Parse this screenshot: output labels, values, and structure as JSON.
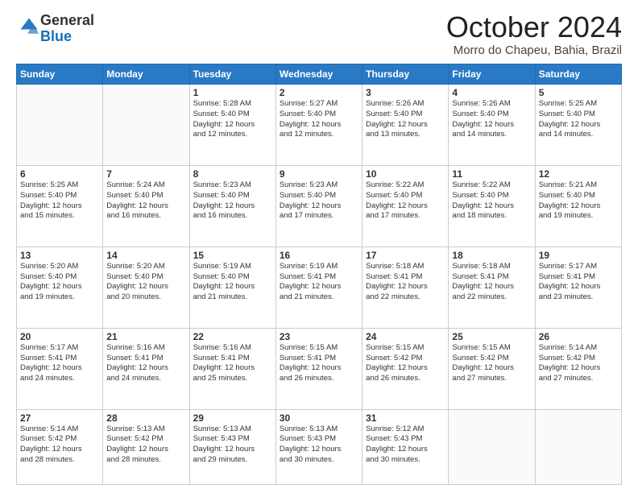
{
  "logo": {
    "general": "General",
    "blue": "Blue"
  },
  "header": {
    "month": "October 2024",
    "location": "Morro do Chapeu, Bahia, Brazil"
  },
  "weekdays": [
    "Sunday",
    "Monday",
    "Tuesday",
    "Wednesday",
    "Thursday",
    "Friday",
    "Saturday"
  ],
  "weeks": [
    [
      {
        "day": null
      },
      {
        "day": null
      },
      {
        "day": "1",
        "sunrise": "5:28 AM",
        "sunset": "5:40 PM",
        "daylight": "12 hours and 12 minutes."
      },
      {
        "day": "2",
        "sunrise": "5:27 AM",
        "sunset": "5:40 PM",
        "daylight": "12 hours and 12 minutes."
      },
      {
        "day": "3",
        "sunrise": "5:26 AM",
        "sunset": "5:40 PM",
        "daylight": "12 hours and 13 minutes."
      },
      {
        "day": "4",
        "sunrise": "5:26 AM",
        "sunset": "5:40 PM",
        "daylight": "12 hours and 14 minutes."
      },
      {
        "day": "5",
        "sunrise": "5:25 AM",
        "sunset": "5:40 PM",
        "daylight": "12 hours and 14 minutes."
      }
    ],
    [
      {
        "day": "6",
        "sunrise": "5:25 AM",
        "sunset": "5:40 PM",
        "daylight": "12 hours and 15 minutes."
      },
      {
        "day": "7",
        "sunrise": "5:24 AM",
        "sunset": "5:40 PM",
        "daylight": "12 hours and 16 minutes."
      },
      {
        "day": "8",
        "sunrise": "5:23 AM",
        "sunset": "5:40 PM",
        "daylight": "12 hours and 16 minutes."
      },
      {
        "day": "9",
        "sunrise": "5:23 AM",
        "sunset": "5:40 PM",
        "daylight": "12 hours and 17 minutes."
      },
      {
        "day": "10",
        "sunrise": "5:22 AM",
        "sunset": "5:40 PM",
        "daylight": "12 hours and 17 minutes."
      },
      {
        "day": "11",
        "sunrise": "5:22 AM",
        "sunset": "5:40 PM",
        "daylight": "12 hours and 18 minutes."
      },
      {
        "day": "12",
        "sunrise": "5:21 AM",
        "sunset": "5:40 PM",
        "daylight": "12 hours and 19 minutes."
      }
    ],
    [
      {
        "day": "13",
        "sunrise": "5:20 AM",
        "sunset": "5:40 PM",
        "daylight": "12 hours and 19 minutes."
      },
      {
        "day": "14",
        "sunrise": "5:20 AM",
        "sunset": "5:40 PM",
        "daylight": "12 hours and 20 minutes."
      },
      {
        "day": "15",
        "sunrise": "5:19 AM",
        "sunset": "5:40 PM",
        "daylight": "12 hours and 21 minutes."
      },
      {
        "day": "16",
        "sunrise": "5:19 AM",
        "sunset": "5:41 PM",
        "daylight": "12 hours and 21 minutes."
      },
      {
        "day": "17",
        "sunrise": "5:18 AM",
        "sunset": "5:41 PM",
        "daylight": "12 hours and 22 minutes."
      },
      {
        "day": "18",
        "sunrise": "5:18 AM",
        "sunset": "5:41 PM",
        "daylight": "12 hours and 22 minutes."
      },
      {
        "day": "19",
        "sunrise": "5:17 AM",
        "sunset": "5:41 PM",
        "daylight": "12 hours and 23 minutes."
      }
    ],
    [
      {
        "day": "20",
        "sunrise": "5:17 AM",
        "sunset": "5:41 PM",
        "daylight": "12 hours and 24 minutes."
      },
      {
        "day": "21",
        "sunrise": "5:16 AM",
        "sunset": "5:41 PM",
        "daylight": "12 hours and 24 minutes."
      },
      {
        "day": "22",
        "sunrise": "5:16 AM",
        "sunset": "5:41 PM",
        "daylight": "12 hours and 25 minutes."
      },
      {
        "day": "23",
        "sunrise": "5:15 AM",
        "sunset": "5:41 PM",
        "daylight": "12 hours and 26 minutes."
      },
      {
        "day": "24",
        "sunrise": "5:15 AM",
        "sunset": "5:42 PM",
        "daylight": "12 hours and 26 minutes."
      },
      {
        "day": "25",
        "sunrise": "5:15 AM",
        "sunset": "5:42 PM",
        "daylight": "12 hours and 27 minutes."
      },
      {
        "day": "26",
        "sunrise": "5:14 AM",
        "sunset": "5:42 PM",
        "daylight": "12 hours and 27 minutes."
      }
    ],
    [
      {
        "day": "27",
        "sunrise": "5:14 AM",
        "sunset": "5:42 PM",
        "daylight": "12 hours and 28 minutes."
      },
      {
        "day": "28",
        "sunrise": "5:13 AM",
        "sunset": "5:42 PM",
        "daylight": "12 hours and 28 minutes."
      },
      {
        "day": "29",
        "sunrise": "5:13 AM",
        "sunset": "5:43 PM",
        "daylight": "12 hours and 29 minutes."
      },
      {
        "day": "30",
        "sunrise": "5:13 AM",
        "sunset": "5:43 PM",
        "daylight": "12 hours and 30 minutes."
      },
      {
        "day": "31",
        "sunrise": "5:12 AM",
        "sunset": "5:43 PM",
        "daylight": "12 hours and 30 minutes."
      },
      {
        "day": null
      },
      {
        "day": null
      }
    ]
  ],
  "labels": {
    "sunrise": "Sunrise:",
    "sunset": "Sunset:",
    "daylight": "Daylight:"
  }
}
